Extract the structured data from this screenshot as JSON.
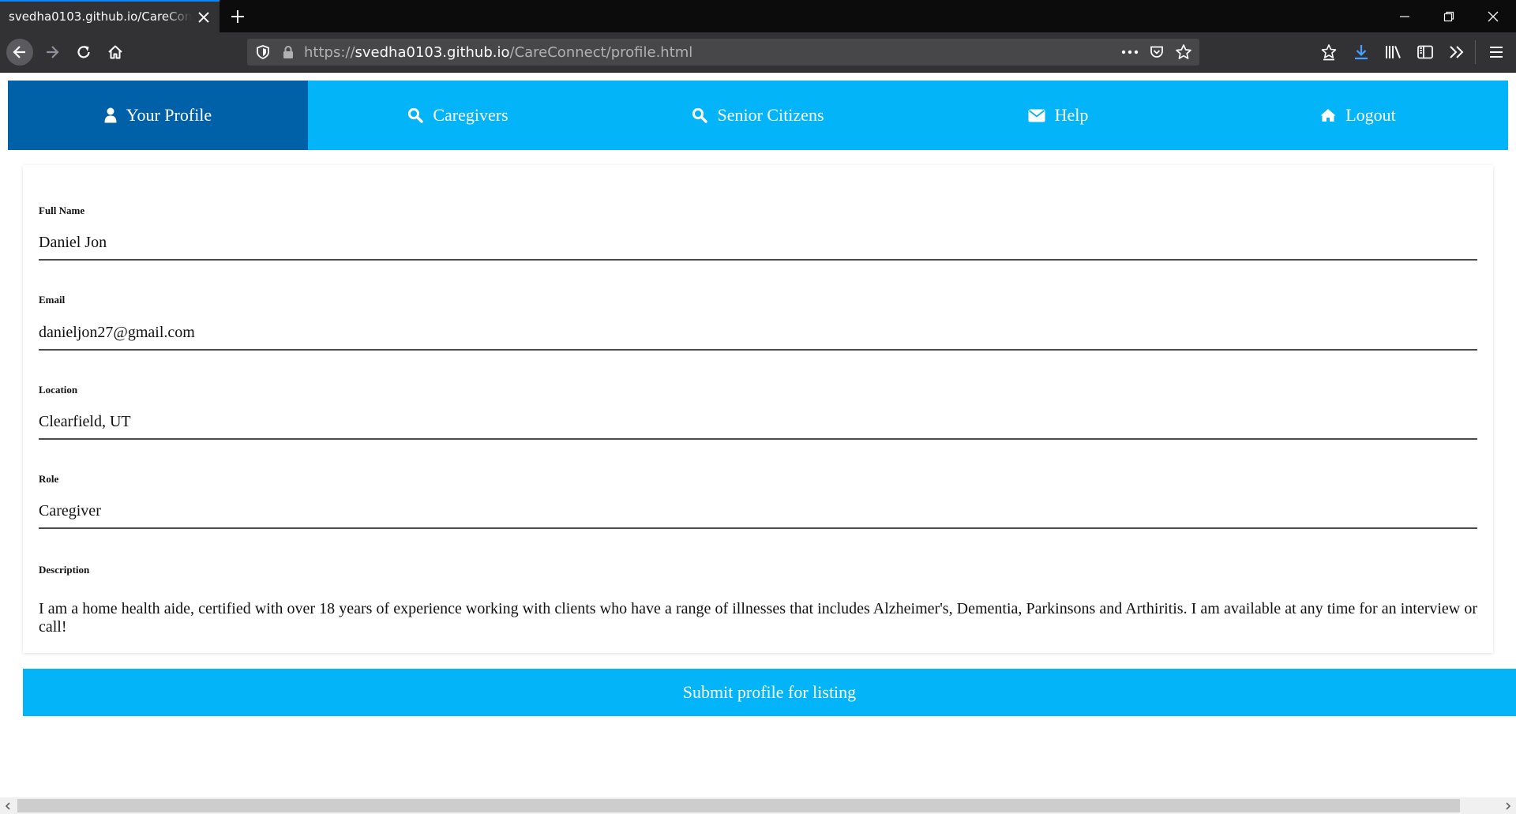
{
  "browser": {
    "tab_title": "svedha0103.github.io/CareConnect/profile.html",
    "url_host": "svedha0103.github.io",
    "url_scheme": "https://",
    "url_path": "/CareConnect/profile.html"
  },
  "nav": {
    "items": [
      {
        "label": "Your Profile",
        "icon": "user-icon",
        "active": true
      },
      {
        "label": "Caregivers",
        "icon": "search-icon",
        "active": false
      },
      {
        "label": "Senior Citizens",
        "icon": "search-icon",
        "active": false
      },
      {
        "label": "Help",
        "icon": "envelope-icon",
        "active": false
      },
      {
        "label": "Logout",
        "icon": "home-icon",
        "active": false
      }
    ]
  },
  "form": {
    "full_name_label": "Full Name",
    "full_name_value": "Daniel Jon",
    "email_label": "Email",
    "email_value": "danieljon27@gmail.com",
    "location_label": "Location",
    "location_value": "Clearfield, UT",
    "role_label": "Role",
    "role_value": "Caregiver",
    "description_label": "Description",
    "description_value": "I am a home health aide, certified with over 18 years of experience working with clients who have a range of illnesses that includes Alzheimer's, Dementia, Parkinsons and Arthiritis. I am available at any time for an interview or call!",
    "submit_label": "Submit profile for listing"
  },
  "colors": {
    "nav_bg": "#03b4f9",
    "nav_active_bg": "#0060a8",
    "button_bg": "#03b4f9"
  }
}
